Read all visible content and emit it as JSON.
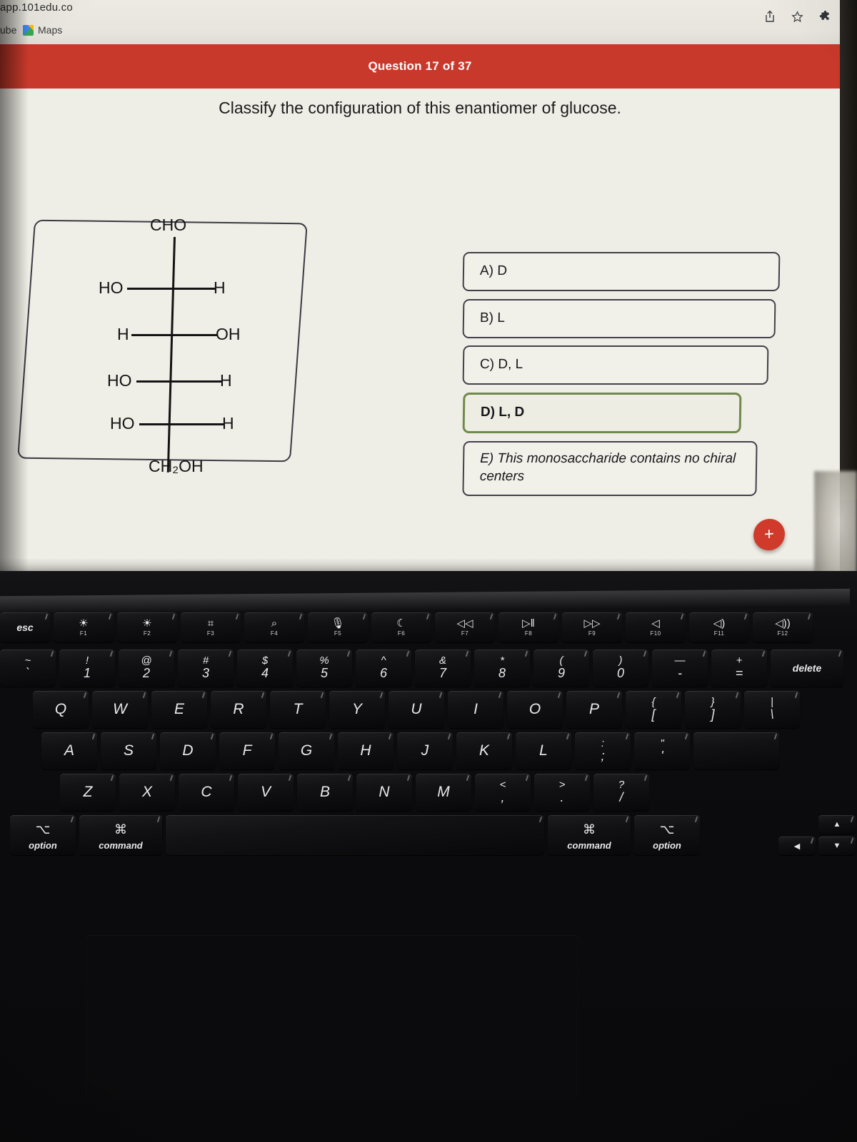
{
  "browser": {
    "url": "app.101edu.co",
    "bookmarks": [
      {
        "label": "ube",
        "icon": "youtube-icon"
      },
      {
        "label": "Maps",
        "icon": "maps-icon"
      }
    ],
    "toolbar_icons": [
      {
        "name": "share-icon"
      },
      {
        "name": "star-icon"
      },
      {
        "name": "extensions-puzzle-icon"
      }
    ]
  },
  "quiz": {
    "header": "Question 17 of 37",
    "header_color": "#c8392b",
    "prompt": "Classify the configuration of this enantiomer of glucose.",
    "answers": [
      {
        "label": "A) D",
        "selected": false
      },
      {
        "label": "B) L",
        "selected": false
      },
      {
        "label": "C) D, L",
        "selected": false
      },
      {
        "label": "D) L, D",
        "selected": true
      },
      {
        "label": "E) This monosaccharide contains no chiral centers",
        "selected": false
      }
    ],
    "selected_border_color": "#6f8a4a",
    "fab_label": "+",
    "fab_color": "#cf3a2b"
  },
  "molecule": {
    "top_group": "CHO",
    "bottom_group": "CH₂OH",
    "rows": [
      {
        "left": "HO",
        "right": "H"
      },
      {
        "left": "H",
        "right": "OH"
      },
      {
        "left": "HO",
        "right": "H"
      },
      {
        "left": "HO",
        "right": "H"
      }
    ]
  },
  "keyboard": {
    "function_row": [
      {
        "label": "esc",
        "kind": "word"
      },
      {
        "glyph": "☼",
        "fn": "F1"
      },
      {
        "glyph": "☀",
        "fn": "F2"
      },
      {
        "glyph": "☰",
        "fn": "F3"
      },
      {
        "glyph": "ὐD",
        "fn": "F4"
      },
      {
        "glyph": "Ἲ4",
        "fn": "F5"
      },
      {
        "glyph": "☾",
        "fn": "F6"
      },
      {
        "glyph": "◁◁",
        "fn": "F7"
      },
      {
        "glyph": "▷‖",
        "fn": "F8"
      },
      {
        "glyph": "▷▷",
        "fn": "F9"
      },
      {
        "glyph": "ὐ7",
        "fn": "F10"
      },
      {
        "glyph": "ὐ8",
        "fn": "F11"
      },
      {
        "glyph": "ὐA",
        "fn": "F12"
      }
    ],
    "number_row": [
      {
        "top": "~",
        "bot": "`"
      },
      {
        "top": "!",
        "bot": "1"
      },
      {
        "top": "@",
        "bot": "2"
      },
      {
        "top": "#",
        "bot": "3"
      },
      {
        "top": "$",
        "bot": "4"
      },
      {
        "top": "%",
        "bot": "5"
      },
      {
        "top": "^",
        "bot": "6"
      },
      {
        "top": "&",
        "bot": "7"
      },
      {
        "top": "*",
        "bot": "8"
      },
      {
        "top": "(",
        "bot": "9"
      },
      {
        "top": ")",
        "bot": "0"
      },
      {
        "top": "—",
        "bot": "-"
      },
      {
        "top": "+",
        "bot": "="
      },
      {
        "label": "delete",
        "kind": "word"
      }
    ],
    "top_letter_row": [
      {
        "label": "Q"
      },
      {
        "label": "W"
      },
      {
        "label": "E"
      },
      {
        "label": "R"
      },
      {
        "label": "T"
      },
      {
        "label": "Y"
      },
      {
        "label": "U"
      },
      {
        "label": "I"
      },
      {
        "label": "O"
      },
      {
        "label": "P"
      },
      {
        "top": "{",
        "bot": "["
      },
      {
        "top": "}",
        "bot": "]"
      },
      {
        "top": "|",
        "bot": "\\"
      }
    ],
    "home_row": [
      {
        "label": "A"
      },
      {
        "label": "S"
      },
      {
        "label": "D"
      },
      {
        "label": "F"
      },
      {
        "label": "G"
      },
      {
        "label": "H"
      },
      {
        "label": "J"
      },
      {
        "label": "K"
      },
      {
        "label": "L"
      },
      {
        "top": ":",
        "bot": ";"
      },
      {
        "top": "\"",
        "bot": "'"
      },
      {
        "label": "",
        "kind": "return"
      }
    ],
    "bottom_letter_row": [
      {
        "label": "Z"
      },
      {
        "label": "X"
      },
      {
        "label": "C"
      },
      {
        "label": "V"
      },
      {
        "label": "B"
      },
      {
        "label": "N"
      },
      {
        "label": "M"
      },
      {
        "top": "<",
        "bot": ","
      },
      {
        "top": ">",
        "bot": "."
      },
      {
        "top": "?",
        "bot": "/"
      }
    ],
    "modifier_row": [
      {
        "glyph": "⌥",
        "label": "option",
        "side": "left"
      },
      {
        "glyph": "⌘",
        "label": "command",
        "side": "left"
      },
      {
        "label": "",
        "kind": "space"
      },
      {
        "glyph": "⌘",
        "label": "command",
        "side": "right"
      },
      {
        "glyph": "⌥",
        "label": "option",
        "side": "right"
      }
    ],
    "arrow_keys": [
      {
        "name": "arrow-up",
        "glyph": "▲"
      },
      {
        "name": "arrow-left",
        "glyph": "◀"
      },
      {
        "name": "arrow-down",
        "glyph": "▼"
      },
      {
        "name": "arrow-right",
        "glyph": "▶"
      }
    ]
  }
}
